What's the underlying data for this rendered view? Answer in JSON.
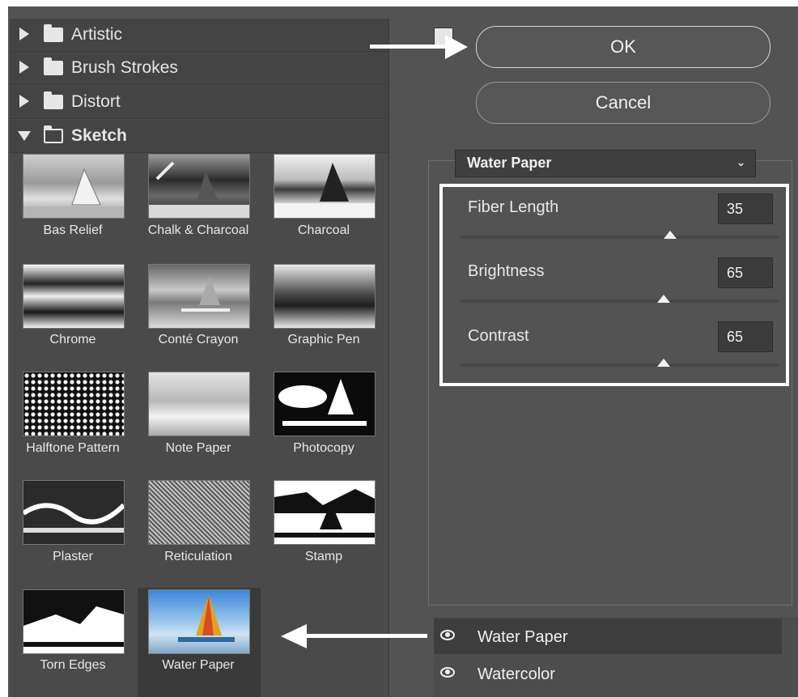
{
  "gallery": {
    "categories": [
      {
        "label": "Artistic",
        "expanded": false
      },
      {
        "label": "Brush Strokes",
        "expanded": false
      },
      {
        "label": "Distort",
        "expanded": false
      },
      {
        "label": "Sketch",
        "expanded": true
      }
    ],
    "thumbnails": [
      {
        "label": "Bas Relief"
      },
      {
        "label": "Chalk & Charcoal"
      },
      {
        "label": "Charcoal"
      },
      {
        "label": "Chrome"
      },
      {
        "label": "Conté Crayon"
      },
      {
        "label": "Graphic Pen"
      },
      {
        "label": "Halftone Pattern"
      },
      {
        "label": "Note Paper"
      },
      {
        "label": "Photocopy"
      },
      {
        "label": "Plaster"
      },
      {
        "label": "Reticulation"
      },
      {
        "label": "Stamp"
      },
      {
        "label": "Torn Edges"
      },
      {
        "label": "Water Paper",
        "selected": true
      }
    ]
  },
  "buttons": {
    "ok": "OK",
    "cancel": "Cancel"
  },
  "filter_select": {
    "value": "Water Paper"
  },
  "params": [
    {
      "label": "Fiber Length",
      "value": "35",
      "fraction": 0.66
    },
    {
      "label": "Brightness",
      "value": "65",
      "fraction": 0.64
    },
    {
      "label": "Contrast",
      "value": "65",
      "fraction": 0.64
    }
  ],
  "layers": [
    {
      "name": "Water Paper",
      "active": true
    },
    {
      "name": "Watercolor",
      "active": false
    }
  ],
  "colors": {
    "panel": "#535353",
    "gallery": "#4a4a4a",
    "highlight": "#ffffff"
  }
}
